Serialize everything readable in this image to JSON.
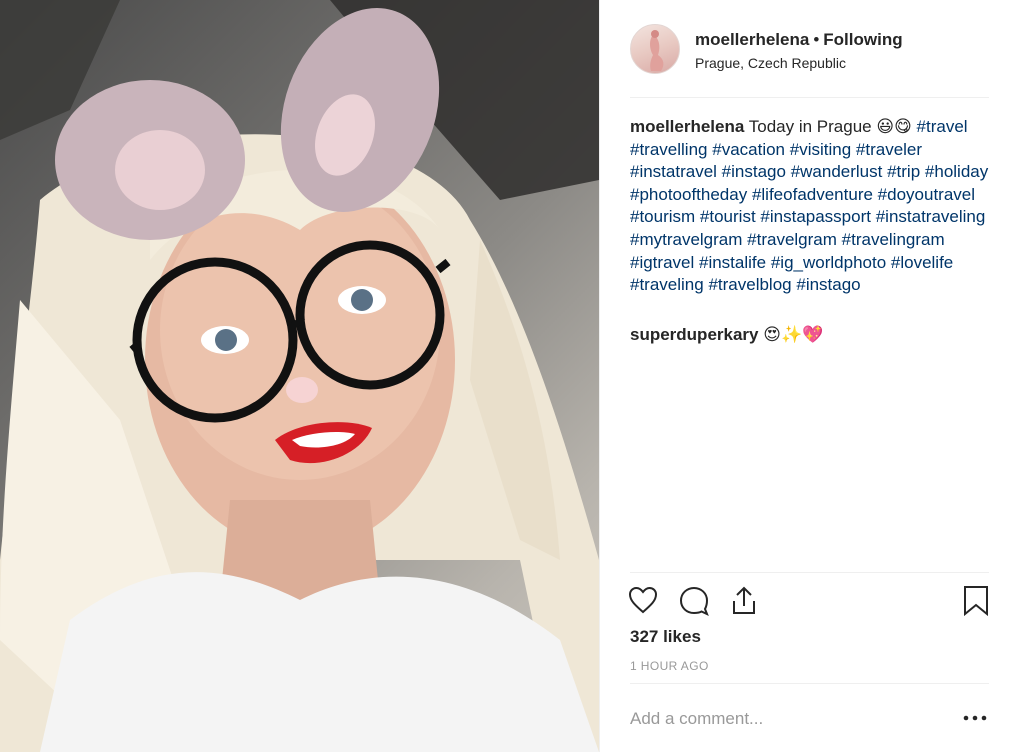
{
  "post": {
    "username": "moellerhelena",
    "separator": "•",
    "follow_state": "Following",
    "location": "Prague, Czech Republic"
  },
  "caption": {
    "username": "moellerhelena",
    "text": "Today in Prague",
    "emojis": "😃😋",
    "hashtags": [
      "#travel",
      "#travelling",
      "#vacation",
      "#visiting",
      "#traveler",
      "#instatravel",
      "#instago",
      "#wanderlust",
      "#trip",
      "#holiday",
      "#photooftheday",
      "#lifeofadventure",
      "#doyoutravel",
      "#tourism",
      "#tourist",
      "#instapassport",
      "#instatraveling",
      "#mytravelgram",
      "#travelgram",
      "#travelingram",
      "#igtravel",
      "#instalife",
      "#ig_worldphoto",
      "#lovelife",
      "#traveling",
      "#travelblog",
      "#instago"
    ]
  },
  "comments": [
    {
      "username": "superduperkary",
      "text": "😍✨💖"
    }
  ],
  "stats": {
    "likes": "327 likes",
    "time": "1 HOUR AGO"
  },
  "comment_box": {
    "placeholder": "Add a comment..."
  },
  "icons": {
    "like": "heart-icon",
    "comment": "comment-bubble-icon",
    "share": "share-upload-icon",
    "save": "bookmark-icon",
    "more": "more-options-icon"
  },
  "colors": {
    "hashtag": "#003569",
    "muted": "#999999",
    "text": "#262626",
    "divider": "#efefef"
  }
}
